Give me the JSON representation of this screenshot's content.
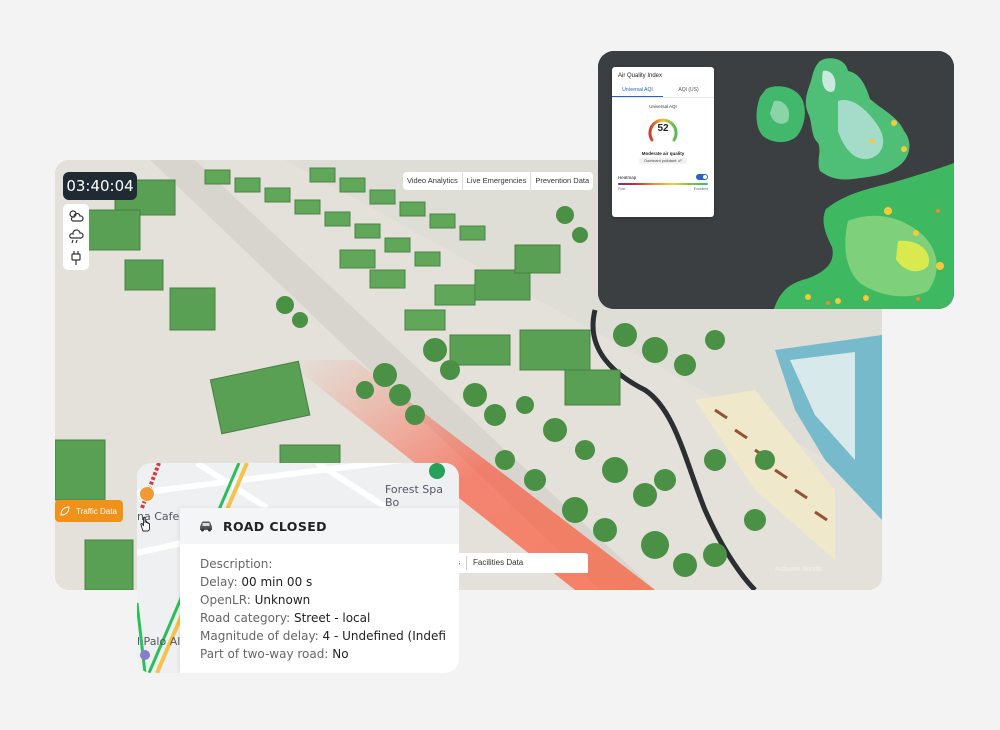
{
  "scene": {
    "clock": "03:40:04",
    "tabs": [
      "Video Analytics",
      "Live Emergencies",
      "Prevention Data"
    ],
    "traffic_button": "Traffic Data",
    "bottom_tabs": [
      "s",
      "Facilities Data"
    ],
    "watermark": "Activate Windo"
  },
  "air_quality": {
    "title": "Air Quality Index",
    "tabs": [
      "Universal AQI",
      "AQI (US)"
    ],
    "active_tab": "Universal AQI",
    "subtitle": "Universal AQI",
    "value": "52",
    "quality": "Moderate air quality",
    "dominant": "Dominant pollutant: o³",
    "heatmap_label": "Heatmap",
    "heatmap_on": true,
    "scale_low": "Poor",
    "scale_high": "Excellent",
    "colors": {
      "accent": "#2a62c9",
      "map_bg": "#3b3f42"
    }
  },
  "road_popup": {
    "street_top": "Forest Spa Bo",
    "street_left": "na Cafe",
    "street_bottom": "l Palo Al",
    "title": "ROAD CLOSED",
    "rows": [
      {
        "label": "Description:",
        "value": ""
      },
      {
        "label": "Delay: ",
        "value": "00 min 00 s"
      },
      {
        "label": "OpenLR: ",
        "value": "Unknown"
      },
      {
        "label": "Road category: ",
        "value": "Street - local"
      },
      {
        "label": "Magnitude of delay: ",
        "value": "4 - Undefined (Indefi"
      },
      {
        "label": "Part of two-way road: ",
        "value": "No"
      }
    ]
  },
  "icons": [
    "weather-icon",
    "cloud-rain-icon",
    "plug-icon",
    "leaf-icon",
    "car-icon",
    "coffee-icon",
    "hand-cursor-icon",
    "location-pin-icon"
  ]
}
